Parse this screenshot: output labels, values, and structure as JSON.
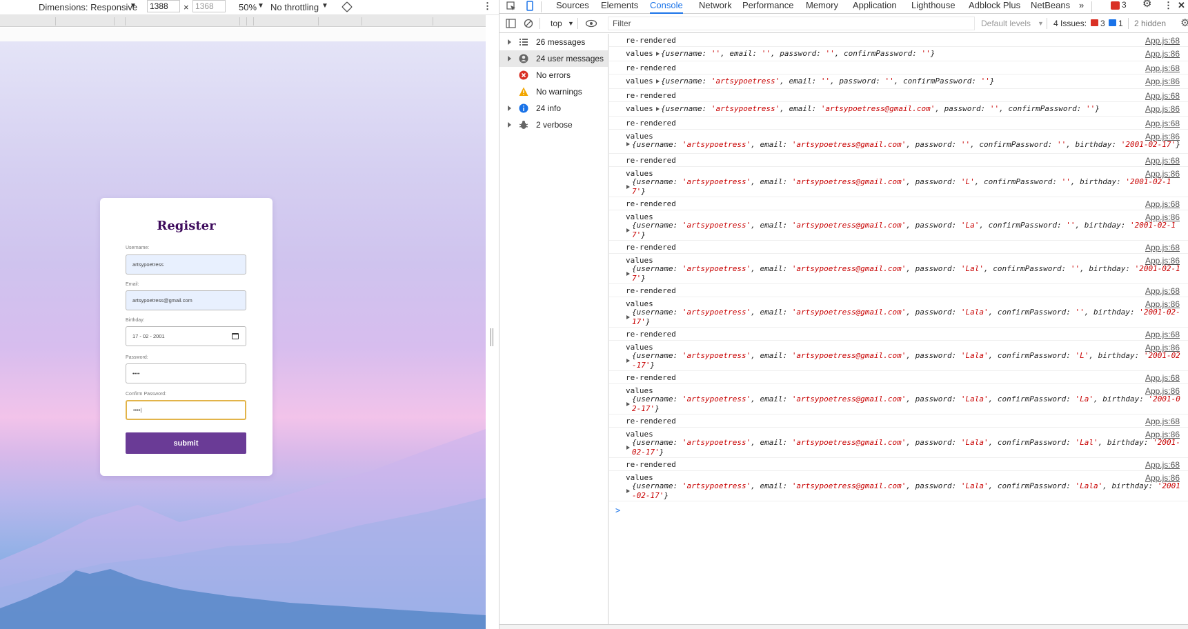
{
  "device_toolbar": {
    "dimensions_label": "Dimensions: Responsive",
    "width_value": "1388",
    "height_placeholder": "1368",
    "times": "×",
    "zoom": "50%",
    "throttling": "No throttling"
  },
  "register_form": {
    "title": "Register",
    "username_label": "Username:",
    "username_value": "artsypoetress",
    "email_label": "Email:",
    "email_value": "artsypoetress@gmail.com",
    "birthday_label": "Birthday:",
    "birthday_value": "17 - 02 - 2001",
    "password_label": "Password:",
    "password_value": "••••",
    "confirm_label": "Confirm Password:",
    "confirm_value": "••••|",
    "submit_label": "submit"
  },
  "devtools": {
    "tabs": [
      "Sources",
      "Elements",
      "Console",
      "Network",
      "Performance",
      "Memory",
      "Application",
      "Lighthouse",
      "Adblock Plus",
      "NetBeans"
    ],
    "active_tab": "Console",
    "more_tabs": "»",
    "error_count": "3",
    "context": "top",
    "filter_placeholder": "Filter",
    "levels": "Default levels",
    "issues_label": "4 Issues:",
    "issues_errors": "3",
    "issues_info": "1",
    "hidden": "2 hidden"
  },
  "sidebar": [
    {
      "label": "26 messages",
      "icon": "list-icon"
    },
    {
      "label": "24 user messages",
      "icon": "user-icon"
    },
    {
      "label": "No errors",
      "icon": "error-icon"
    },
    {
      "label": "No warnings",
      "icon": "warning-icon"
    },
    {
      "label": "24 info",
      "icon": "info-icon"
    },
    {
      "label": "2 verbose",
      "icon": "bug-icon"
    }
  ],
  "console": {
    "source_rendered": "App.js:68",
    "source_values": "App.js:86",
    "rendered_text": "re-rendered",
    "values_text": "values",
    "entries": [
      {
        "username": "",
        "email": "",
        "password": "",
        "confirm": ""
      },
      {
        "username": "artsypoetress",
        "email": "",
        "password": "",
        "confirm": ""
      },
      {
        "username": "artsypoetress",
        "email": "artsypoetress@gmail.com",
        "password": "",
        "confirm": ""
      },
      {
        "username": "artsypoetress",
        "email": "artsypoetress@gmail.com",
        "password": "",
        "confirm": "",
        "birthday": "2001-02-17"
      },
      {
        "username": "artsypoetress",
        "email": "artsypoetress@gmail.com",
        "password": "L",
        "confirm": "",
        "birthday": "2001-02-17"
      },
      {
        "username": "artsypoetress",
        "email": "artsypoetress@gmail.com",
        "password": "La",
        "confirm": "",
        "birthday": "2001-02-17"
      },
      {
        "username": "artsypoetress",
        "email": "artsypoetress@gmail.com",
        "password": "Lal",
        "confirm": "",
        "birthday": "2001-02-17"
      },
      {
        "username": "artsypoetress",
        "email": "artsypoetress@gmail.com",
        "password": "Lala",
        "confirm": "",
        "birthday": "2001-02-17"
      },
      {
        "username": "artsypoetress",
        "email": "artsypoetress@gmail.com",
        "password": "Lala",
        "confirm": "L",
        "birthday": "2001-02-17"
      },
      {
        "username": "artsypoetress",
        "email": "artsypoetress@gmail.com",
        "password": "Lala",
        "confirm": "La",
        "birthday": "2001-02-17"
      },
      {
        "username": "artsypoetress",
        "email": "artsypoetress@gmail.com",
        "password": "Lala",
        "confirm": "Lal",
        "birthday": "2001-02-17"
      },
      {
        "username": "artsypoetress",
        "email": "artsypoetress@gmail.com",
        "password": "Lala",
        "confirm": "Lala",
        "birthday": "2001-02-17"
      }
    ],
    "prompt": ">"
  },
  "colors": {
    "accent": "#1a73e8",
    "submit": "#6a3b96",
    "title": "#3d0a5c",
    "value_string": "#c80000"
  }
}
